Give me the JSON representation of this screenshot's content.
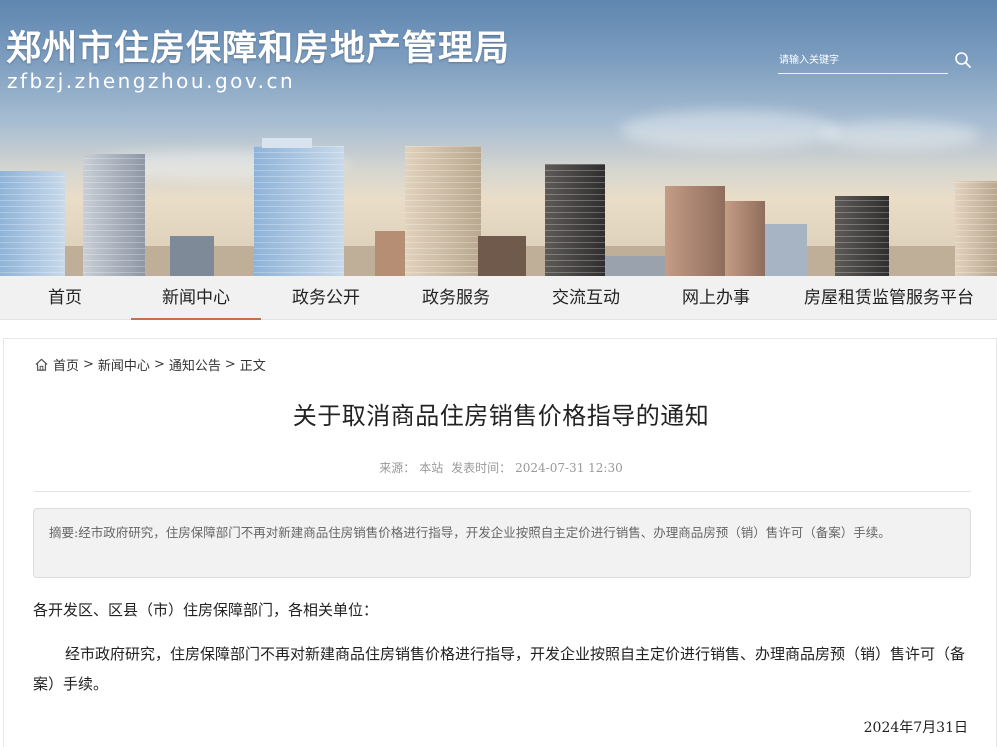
{
  "header": {
    "site_title": "郑州市住房保障和房地产管理局",
    "site_domain": "zfbzj.zhengzhou.gov.cn",
    "search_placeholder": "请输入关键字"
  },
  "nav": {
    "items": [
      {
        "label": "首页",
        "active": false
      },
      {
        "label": "新闻中心",
        "active": true
      },
      {
        "label": "政务公开",
        "active": false
      },
      {
        "label": "政务服务",
        "active": false
      },
      {
        "label": "交流互动",
        "active": false
      },
      {
        "label": "网上办事",
        "active": false
      },
      {
        "label": "房屋租赁监管服务平台",
        "active": false
      }
    ]
  },
  "breadcrumb": {
    "items": [
      "首页",
      "新闻中心",
      "通知公告",
      "正文"
    ],
    "separator": ">"
  },
  "article": {
    "title": "关于取消商品住房销售价格指导的通知",
    "source_label": "来源：",
    "source": "本站",
    "time_label": "发表时间：",
    "time": "2024-07-31 12:30",
    "summary_label": "摘要:",
    "summary": "经市政府研究，住房保障部门不再对新建商品住房销售价格进行指导，开发企业按照自主定价进行销售、办理商品房预（销）售许可（备案）手续。",
    "salutation": "各开发区、区县（市）住房保障部门，各相关单位：",
    "paragraph": "经市政府研究，住房保障部门不再对新建商品住房销售价格进行指导，开发企业按照自主定价进行销售、办理商品房预（销）售许可（备案）手续。",
    "date": "2024年7月31日"
  },
  "colors": {
    "nav_active_underline": "#c7714a",
    "nav_background": "#f1f1f1",
    "summary_background": "#f2f2f2"
  },
  "icons": [
    "search-icon",
    "home-icon"
  ]
}
